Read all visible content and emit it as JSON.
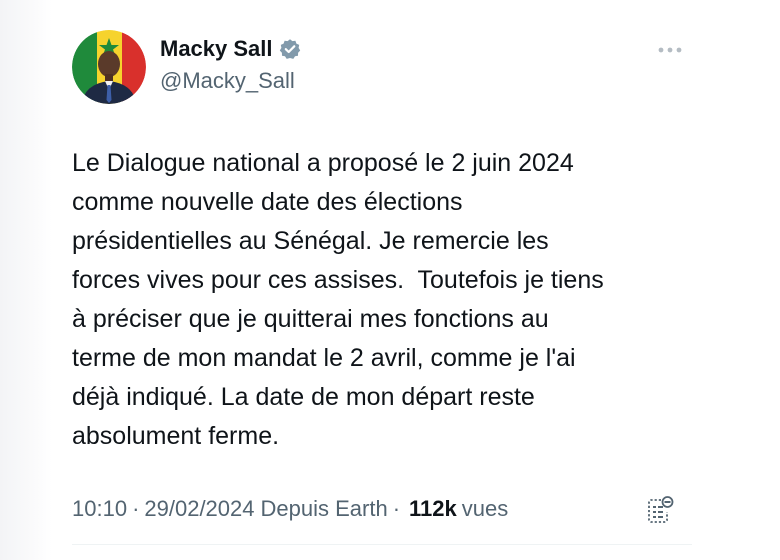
{
  "author": {
    "display_name": "Macky Sall",
    "handle": "@Macky_Sall",
    "verified": true
  },
  "tweet": {
    "text": "Le Dialogue national a proposé le 2 juin 2024\ncomme nouvelle date des élections\nprésidentielles au Sénégal. Je remercie les\nforces vives pour ces assises.  Toutefois je tiens\nà préciser que je quitterai mes fonctions au\nterme de mon mandat le 2 avril, comme je l'ai\ndéjà indiqué. La date de mon départ reste\nabsolument ferme."
  },
  "meta": {
    "time": "10:10",
    "separator": "·",
    "date": "29/02/2024",
    "source": "Depuis Earth",
    "views_count": "112k",
    "views_label": "vues"
  },
  "colors": {
    "text_primary": "#0f1419",
    "text_secondary": "#536471",
    "verified_badge": "#829aab",
    "divider": "#eff3f4"
  },
  "icons": {
    "verified": "verified-badge-icon",
    "more": "more-dots-icon",
    "analytics": "analytics-icon"
  }
}
